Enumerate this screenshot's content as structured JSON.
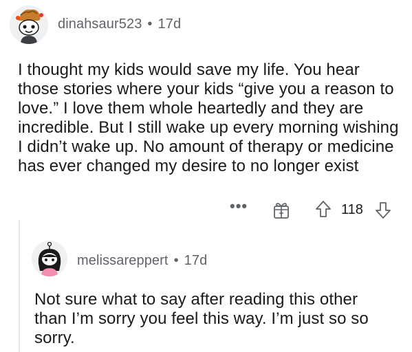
{
  "comments": [
    {
      "username": "dinahsaur523",
      "separator": "•",
      "age": "17d",
      "avatar": "snoo-avatar-chef-hat",
      "body": "I thought my kids would save my life. You hear those stories where your kids “give you a reason to love.” I love them whole heartedly and they are incredible. But I still wake up every morning wishing I didn’t wake up. No amount of therapy or medicine has ever changed my desire to no longer exist",
      "actions": {
        "more_label": "•••",
        "award_icon": "award-gift-icon",
        "upvote_icon": "upvote-arrow-icon",
        "score": "118",
        "downvote_icon": "downvote-arrow-icon"
      }
    },
    {
      "username": "melissareppert",
      "separator": "•",
      "age": "17d",
      "avatar": "snoo-avatar-black-hair",
      "body": "Not sure what to say after reading this other than I’m sorry you feel this way. I’m just so so sorry."
    }
  ],
  "colors": {
    "meta_text": "#5f6368",
    "body_text": "#1a1a1b",
    "thread_line": "#e6e8ea"
  }
}
